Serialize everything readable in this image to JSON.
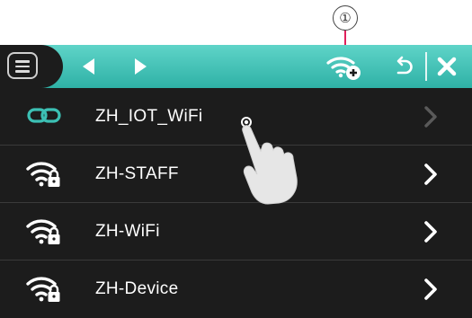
{
  "annotation": {
    "callout_number": "①"
  },
  "toolbar": {
    "icons": [
      "menu-icon",
      "arrow-left-icon",
      "arrow-right-icon",
      "wifi-add-icon",
      "undo-icon",
      "close-icon"
    ],
    "accent": "#3cc0b4"
  },
  "networks": [
    {
      "ssid": "ZH_IOT_WiFi",
      "icon": "link-icon",
      "status": "connected"
    },
    {
      "ssid": "ZH-STAFF",
      "icon": "wifi-locked-icon",
      "status": "secured"
    },
    {
      "ssid": "ZH-WiFi",
      "icon": "wifi-locked-icon",
      "status": "secured"
    },
    {
      "ssid": "ZH-Device",
      "icon": "wifi-locked-icon",
      "status": "secured"
    }
  ],
  "colors": {
    "background": "#1c1c1c",
    "text": "#ffffff",
    "link_icon": "#3cc0b4",
    "chevron_dim": "#5a5a5a"
  }
}
